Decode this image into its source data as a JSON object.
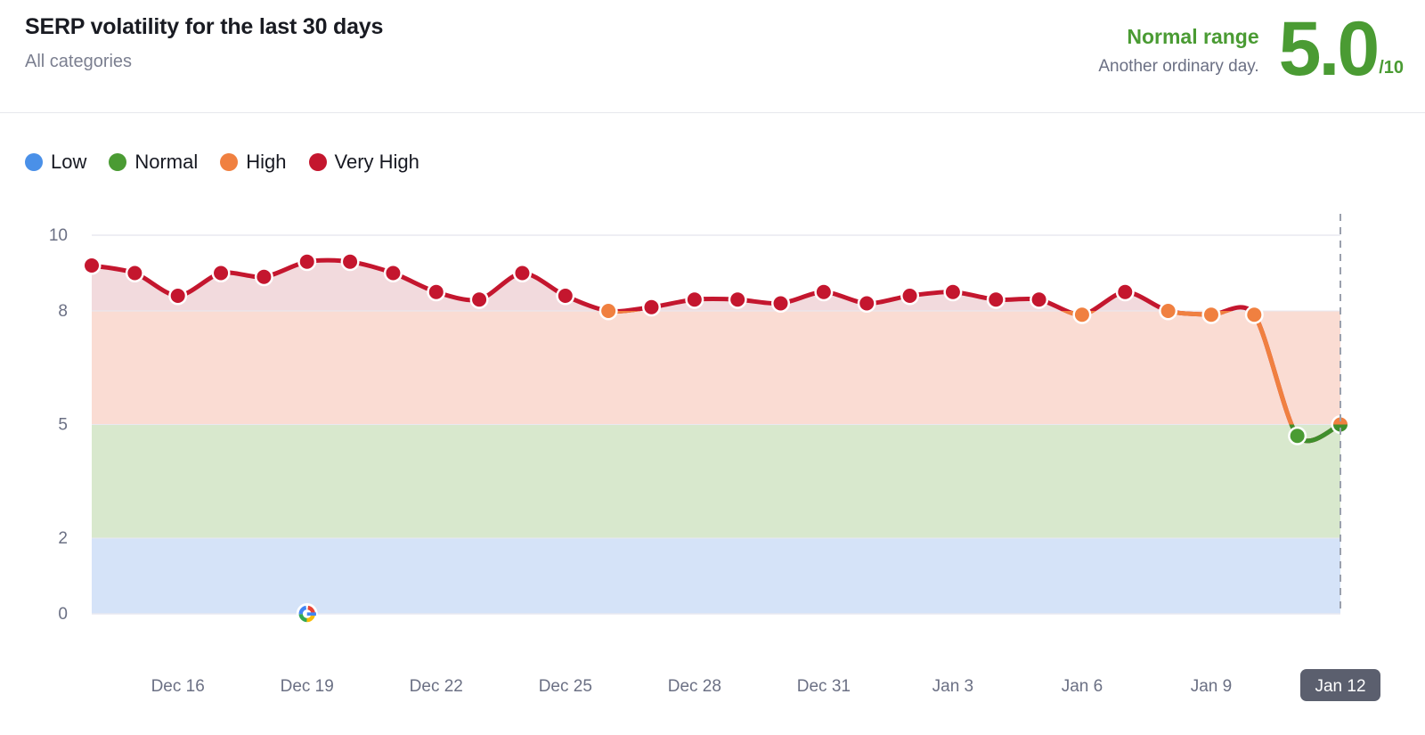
{
  "header": {
    "title": "SERP volatility for the last 30 days",
    "subtitle": "All categories",
    "status": "Normal range",
    "note": "Another ordinary day.",
    "score": "5.0",
    "score_max": "/10"
  },
  "legend": {
    "items": [
      {
        "label": "Low",
        "color": "#4a90e8"
      },
      {
        "label": "Normal",
        "color": "#4a9b33"
      },
      {
        "label": "High",
        "color": "#f08040"
      },
      {
        "label": "Very High",
        "color": "#c4162e"
      }
    ]
  },
  "icons": {
    "google_marker": "google-logo-icon"
  },
  "chart_data": {
    "type": "line",
    "title": "SERP volatility for the last 30 days",
    "subtitle": "All categories",
    "xlabel": "",
    "ylabel": "",
    "ylim": [
      0,
      10
    ],
    "yticks": [
      10,
      8,
      5,
      2,
      0
    ],
    "grid": true,
    "legend_position": "top-left",
    "x": [
      "Dec 14",
      "Dec 15",
      "Dec 16",
      "Dec 17",
      "Dec 18",
      "Dec 19",
      "Dec 20",
      "Dec 21",
      "Dec 22",
      "Dec 23",
      "Dec 24",
      "Dec 25",
      "Dec 26",
      "Dec 27",
      "Dec 28",
      "Dec 29",
      "Dec 30",
      "Dec 31",
      "Jan 1",
      "Jan 2",
      "Jan 3",
      "Jan 4",
      "Jan 5",
      "Jan 6",
      "Jan 7",
      "Jan 8",
      "Jan 9",
      "Jan 10",
      "Jan 11",
      "Jan 12"
    ],
    "xticks": [
      "Dec 16",
      "Dec 19",
      "Dec 22",
      "Dec 25",
      "Dec 28",
      "Dec 31",
      "Jan 3",
      "Jan 6",
      "Jan 9",
      "Jan 12"
    ],
    "current_label": "Jan 12",
    "values": [
      9.2,
      9.0,
      8.4,
      9.0,
      8.9,
      9.3,
      9.3,
      9.0,
      8.5,
      8.3,
      9.0,
      8.4,
      8.0,
      8.1,
      8.3,
      8.3,
      8.2,
      8.5,
      8.2,
      8.4,
      8.5,
      8.3,
      8.3,
      7.9,
      8.5,
      8.0,
      7.9,
      7.9,
      4.7,
      5.0
    ],
    "point_colors": [
      "#c4162e",
      "#c4162e",
      "#c4162e",
      "#c4162e",
      "#c4162e",
      "#c4162e",
      "#c4162e",
      "#c4162e",
      "#c4162e",
      "#c4162e",
      "#c4162e",
      "#c4162e",
      "#f08040",
      "#c4162e",
      "#c4162e",
      "#c4162e",
      "#c4162e",
      "#c4162e",
      "#c4162e",
      "#c4162e",
      "#c4162e",
      "#c4162e",
      "#c4162e",
      "#f08040",
      "#c4162e",
      "#f08040",
      "#f08040",
      "#f08040",
      "#4a9b33",
      "#f08040"
    ],
    "bands": [
      {
        "name": "Low",
        "from": 0,
        "to": 2,
        "color": "#d5e3f8"
      },
      {
        "name": "Normal",
        "from": 2,
        "to": 5,
        "color": "#d8e8cd"
      },
      {
        "name": "High",
        "from": 5,
        "to": 8,
        "color": "#fadcd3"
      },
      {
        "name": "Very High",
        "from": 8,
        "to": 10,
        "color": "#f2dadd"
      }
    ],
    "annotations": [
      {
        "type": "google-update-marker",
        "x": "Dec 19",
        "y": 0
      },
      {
        "type": "current-day-line",
        "x": "Jan 12"
      }
    ]
  }
}
